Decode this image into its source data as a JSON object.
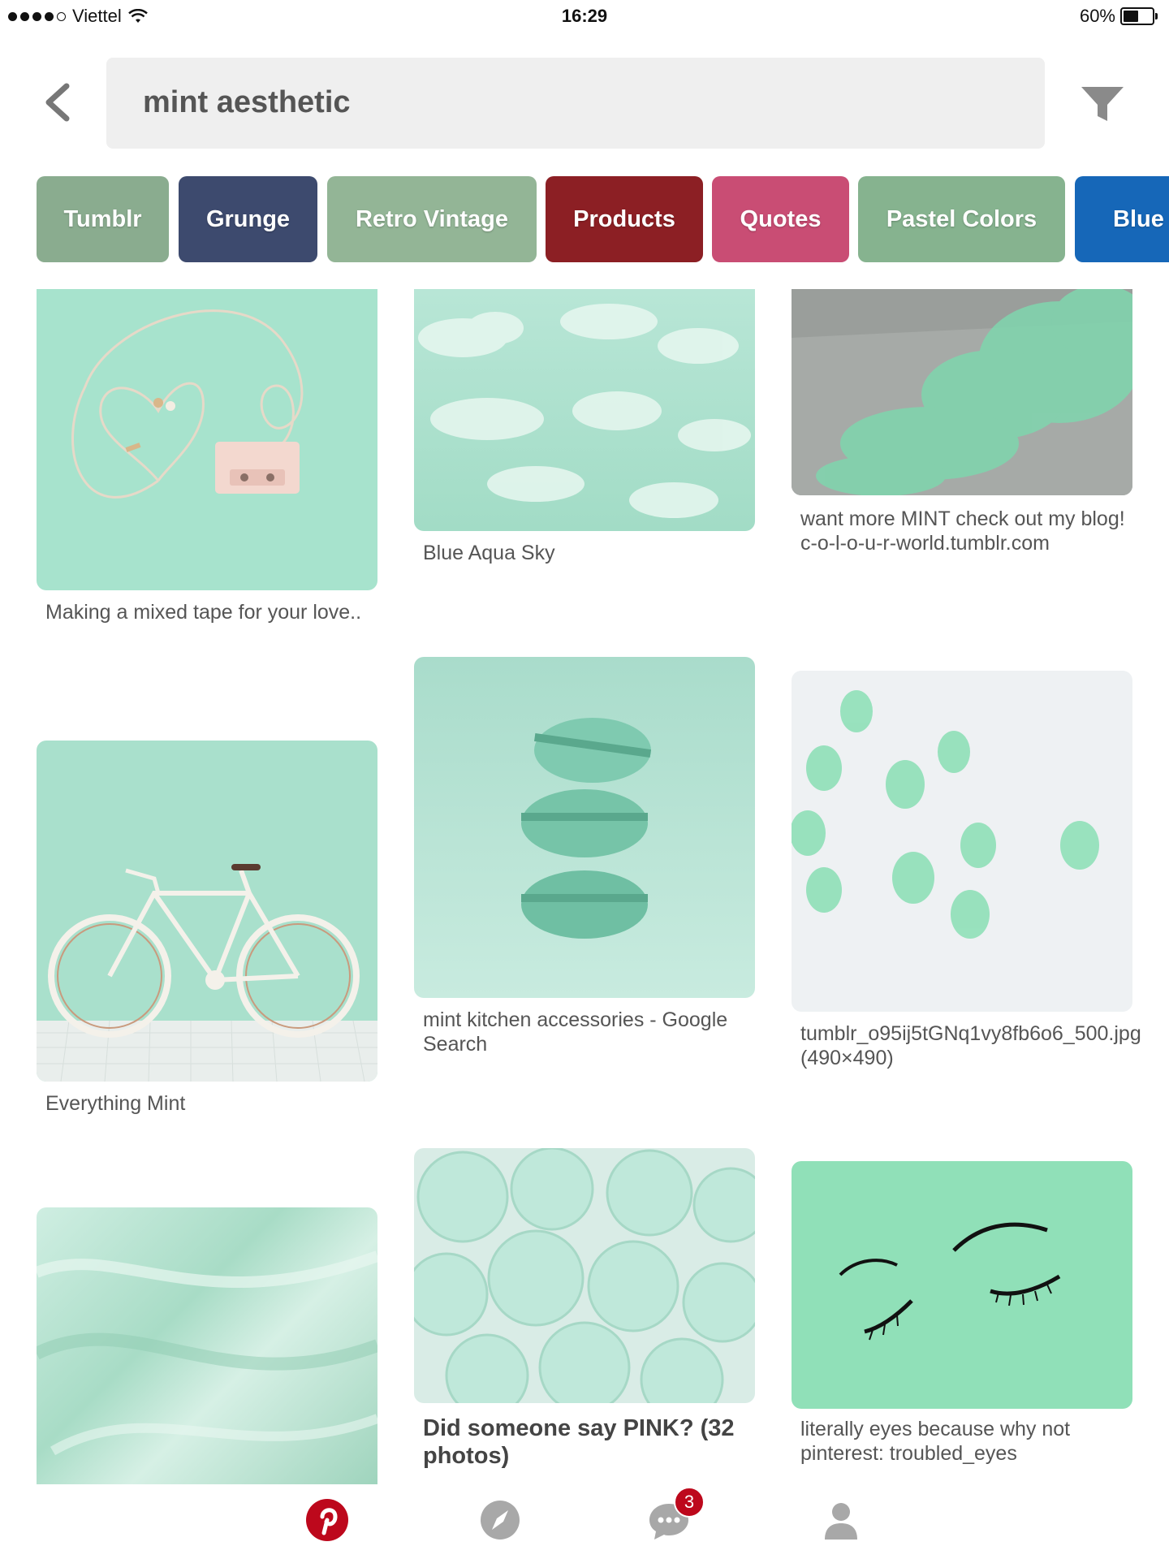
{
  "status_bar": {
    "carrier": "Viettel",
    "time": "16:29",
    "battery": "60%",
    "battery_level": 0.6
  },
  "search": {
    "query": "mint aesthetic"
  },
  "guides": [
    {
      "label": "Tumblr",
      "color": "#8aac8f"
    },
    {
      "label": "Grunge",
      "color": "#3d4a6e"
    },
    {
      "label": "Retro Vintage",
      "color": "#93b596"
    },
    {
      "label": "Products",
      "color": "#8c1f24"
    },
    {
      "label": "Quotes",
      "color": "#c94d74"
    },
    {
      "label": "Pastel Colors",
      "color": "#86b38f"
    },
    {
      "label": "Blue",
      "color": "#1667b8"
    }
  ],
  "pins": [
    {
      "description": "Making a mixed tape for your love..",
      "image": "mint-headphones-cassette"
    },
    {
      "description": "Blue Aqua Sky",
      "image": "mint-clouds"
    },
    {
      "description": "want more MINT check out my blog!  c-o-l-o-u-r-world.tumblr.com",
      "image": "mint-smoke"
    },
    {
      "description": "Everything Mint",
      "image": "mint-bicycle"
    },
    {
      "description": "mint kitchen accessories - Google Search",
      "image": "mint-macarons"
    },
    {
      "description": "tumblr_o95ij5tGNq1vy8fb6o6_500.jpg (490×490)",
      "image": "mint-gummy-bears"
    },
    {
      "description": "",
      "image": "mint-fabric"
    },
    {
      "description": "Did someone say PINK? (32 photos)",
      "image": "mint-ice-cream"
    },
    {
      "description": "literally eyes because why not pinterest: troubled_eyes",
      "image": "mint-eyes-drawing"
    }
  ],
  "tabbar": {
    "items": [
      {
        "name": "home",
        "icon": "pinterest-logo-icon",
        "active": true
      },
      {
        "name": "explore",
        "icon": "compass-icon"
      },
      {
        "name": "notifications",
        "icon": "chat-bubble-icon"
      },
      {
        "name": "profile",
        "icon": "person-icon"
      }
    ],
    "notification_count": "3"
  },
  "colors": {
    "brand_red": "#bd081c",
    "search_bg": "#efefef",
    "mint": "#a8e0cc"
  }
}
